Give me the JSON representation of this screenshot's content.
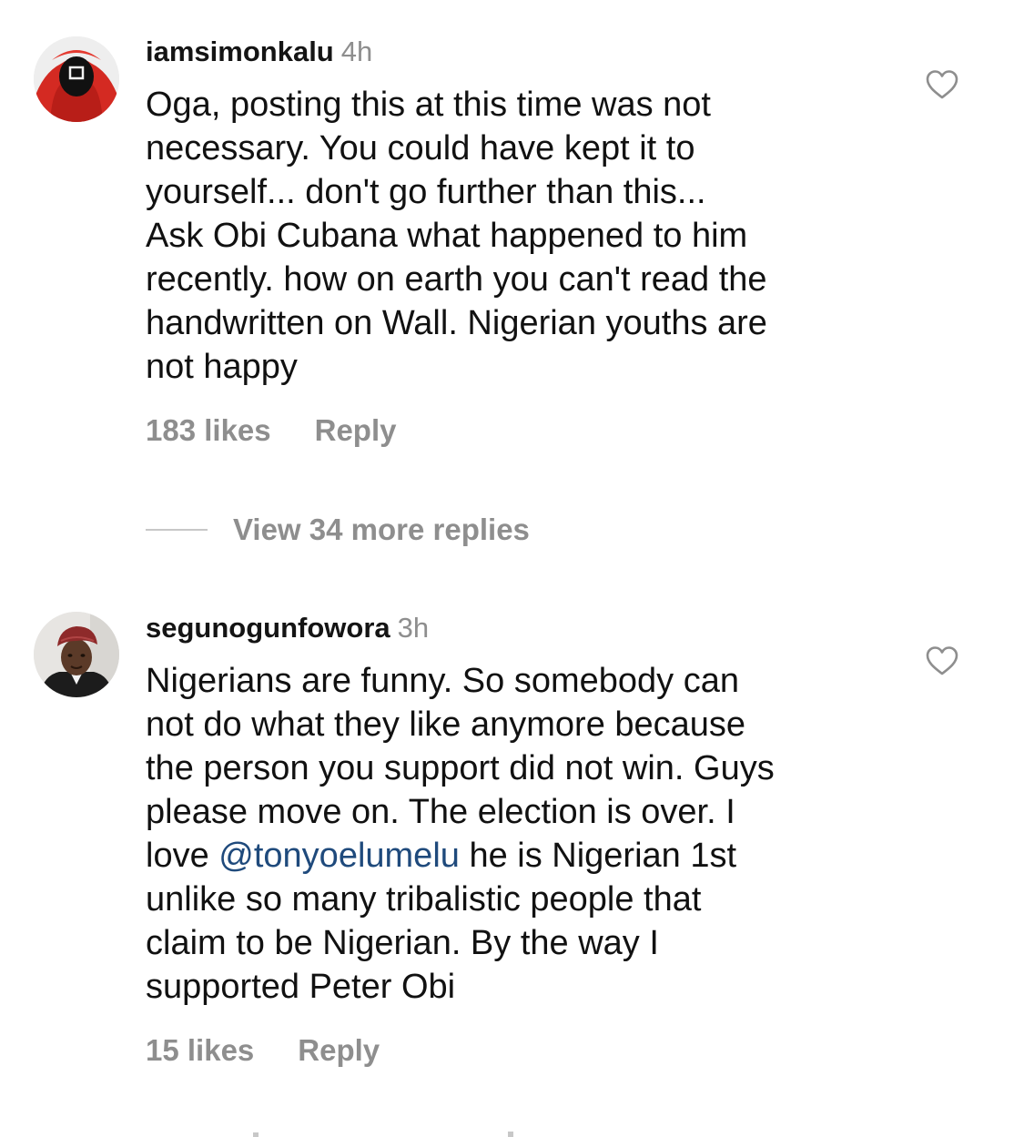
{
  "comments": [
    {
      "username": "iamsimonkalu",
      "timestamp": "4h",
      "lines": [
        "Oga, posting this at this time was not",
        "necessary. You could have kept it to",
        "yourself... don't go further than this...",
        "Ask Obi Cubana what happened to him",
        "recently. how on earth you can't read the",
        "handwritten on Wall. Nigerian youths are",
        "not happy"
      ],
      "likes": "183 likes",
      "reply": "Reply",
      "avatar_icon": "masked-figure-red-hood-avatar",
      "like_icon": "heart-outline-icon"
    },
    {
      "username": "segunogunfowora",
      "timestamp": "3h",
      "lines": [
        "Nigerians are funny. So somebody can",
        "not do what they like anymore because",
        "the person you support did not win. Guys",
        "please move on. The election is over. I"
      ],
      "mention_line": {
        "prefix": "love ",
        "mention": "@tonyoelumelu",
        "suffix": " he is Nigerian 1st"
      },
      "lines_after": [
        "unlike so many tribalistic people that",
        "claim to be Nigerian. By the way I",
        "supported Peter Obi"
      ],
      "likes": "15 likes",
      "reply": "Reply",
      "avatar_icon": "man-red-cap-avatar",
      "like_icon": "heart-outline-icon"
    }
  ],
  "view_replies": "View 34 more replies",
  "colors": {
    "text": "#111111",
    "muted": "#8e8e8e",
    "mention": "#1f4a7c",
    "background": "#ffffff"
  }
}
